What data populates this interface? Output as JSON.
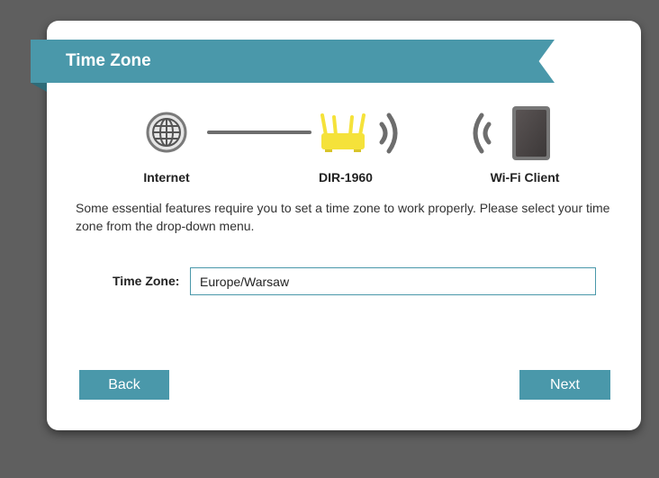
{
  "dialog": {
    "title": "Time Zone"
  },
  "diagram": {
    "internet_label": "Internet",
    "router_label": "DIR-1960",
    "client_label": "Wi-Fi Client",
    "icons": [
      "globe-icon",
      "router-icon",
      "wifi-signal-icon",
      "tablet-icon"
    ]
  },
  "description": "Some essential features require you to set a time zone to work properly. Please select your time zone from the drop-down menu.",
  "form": {
    "time_zone_label": "Time Zone:",
    "time_zone_value": "Europe/Warsaw"
  },
  "buttons": {
    "back": "Back",
    "next": "Next"
  },
  "colors": {
    "accent": "#4a98aa",
    "router": "#f5e23a",
    "background": "#5f5f5f"
  }
}
